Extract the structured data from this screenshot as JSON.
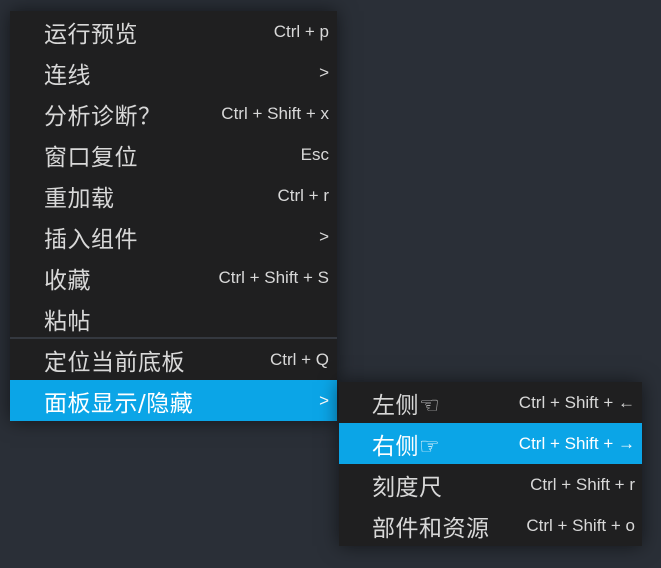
{
  "main_menu": {
    "items": [
      {
        "label": "运行预览",
        "shortcut": "Ctrl + p"
      },
      {
        "label": "连线",
        "shortcut": ">"
      },
      {
        "label": "分析诊断？",
        "shortcut": "Ctrl + Shift + x"
      },
      {
        "label": "窗口复位",
        "shortcut": "Esc"
      },
      {
        "label": "重加载",
        "shortcut": "Ctrl + r"
      },
      {
        "label": "插入组件",
        "shortcut": ">"
      },
      {
        "label": "收藏",
        "shortcut": "Ctrl + Shift + S"
      },
      {
        "label": "粘帖",
        "shortcut": ""
      },
      {
        "label": "定位当前底板",
        "shortcut": "Ctrl + Q"
      },
      {
        "label": "面板显示/隐藏",
        "shortcut": ">",
        "active": true
      }
    ]
  },
  "sub_menu": {
    "items": [
      {
        "label": "左侧☜",
        "shortcut": "Ctrl + Shift + ←"
      },
      {
        "label": "右侧☞",
        "shortcut": "Ctrl + Shift + →",
        "active": true
      },
      {
        "label": "刻度尺",
        "shortcut": "Ctrl + Shift + r"
      },
      {
        "label": "部件和资源",
        "shortcut": "Ctrl + Shift + o"
      }
    ]
  },
  "colors": {
    "background": "#2a2f37",
    "menu_bg": "#1f1f20",
    "highlight": "#0ba5e7",
    "text": "#d8d8d8"
  }
}
